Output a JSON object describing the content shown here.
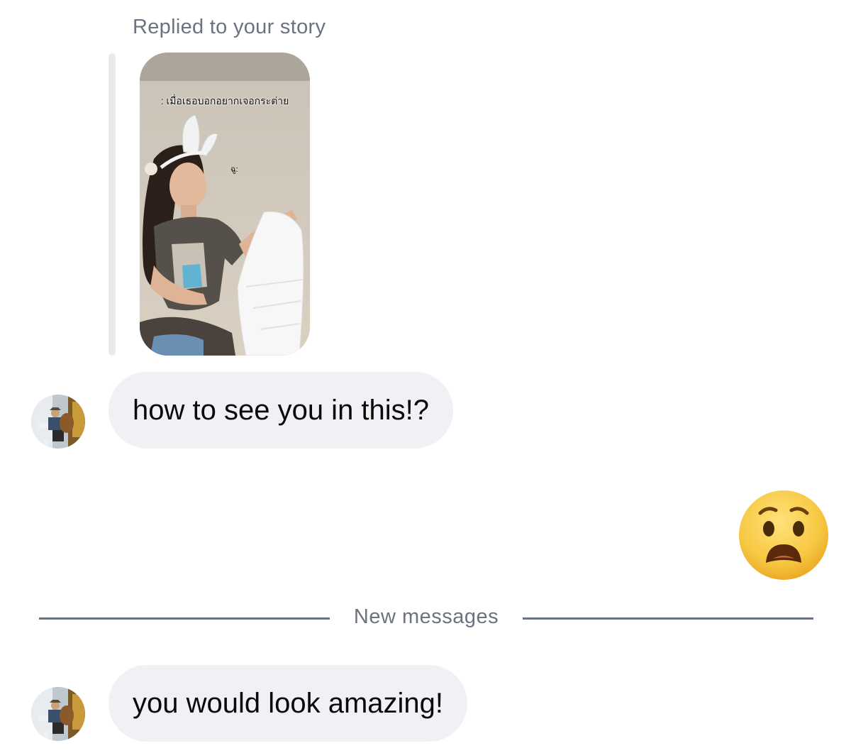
{
  "thread": {
    "reply_context_label": "Replied to your story",
    "story": {
      "caption": ": เมื่อเธอบอกอยากเจอกระต่าย",
      "overlay_text": "ฉู:"
    },
    "messages": [
      {
        "sender": "other",
        "text": "how to see you in this!?"
      },
      {
        "sender": "me",
        "type": "emoji",
        "icon": "anguished-face-emoji"
      },
      {
        "sender": "other",
        "text": "you would look amazing!"
      }
    ],
    "divider_label": "New messages"
  },
  "colors": {
    "bubble_bg": "#eff1f4",
    "meta_text": "#6b7280",
    "emoji_yellow": "#f7c843"
  }
}
